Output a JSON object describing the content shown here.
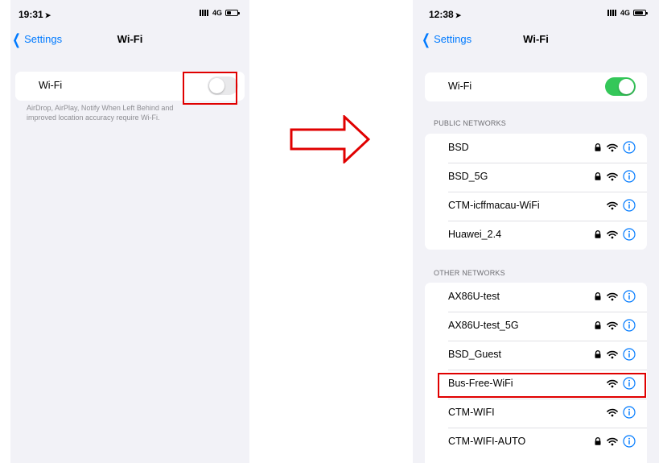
{
  "left": {
    "status": {
      "time": "19:31",
      "network": "4G"
    },
    "nav": {
      "back": "Settings",
      "title": "Wi-Fi"
    },
    "wifi_row": {
      "label": "Wi-Fi",
      "toggle": "off"
    },
    "footnote": "AirDrop, AirPlay, Notify When Left Behind and improved location accuracy require Wi-Fi."
  },
  "right": {
    "status": {
      "time": "12:38",
      "network": "4G"
    },
    "nav": {
      "back": "Settings",
      "title": "Wi-Fi"
    },
    "wifi_row": {
      "label": "Wi-Fi",
      "toggle": "on"
    },
    "public_header": "PUBLIC NETWORKS",
    "public_networks": [
      {
        "name": "BSD",
        "locked": true
      },
      {
        "name": "BSD_5G",
        "locked": true
      },
      {
        "name": "CTM-icffmacau-WiFi",
        "locked": false
      },
      {
        "name": "Huawei_2.4",
        "locked": true
      }
    ],
    "other_header": "OTHER NETWORKS",
    "other_networks": [
      {
        "name": "AX86U-test",
        "locked": true
      },
      {
        "name": "AX86U-test_5G",
        "locked": true
      },
      {
        "name": "BSD_Guest",
        "locked": true
      },
      {
        "name": "Bus-Free-WiFi",
        "locked": false
      },
      {
        "name": "CTM-WIFI",
        "locked": false
      },
      {
        "name": "CTM-WIFI-AUTO",
        "locked": true
      }
    ]
  },
  "colors": {
    "accent": "#007aff",
    "toggle_on": "#34c759",
    "highlight": "#e00000"
  },
  "icons": [
    "location-arrow-icon",
    "signal-icon",
    "battery-icon",
    "chevron-left-icon",
    "lock-icon",
    "wifi-icon",
    "info-icon",
    "right-arrow-icon"
  ]
}
